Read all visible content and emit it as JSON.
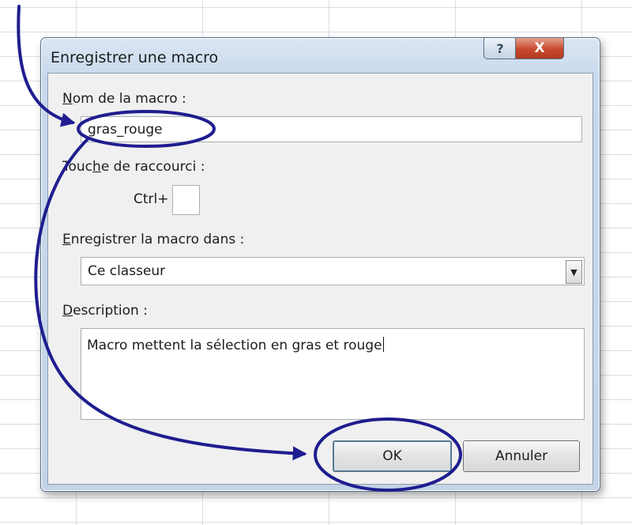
{
  "dialog": {
    "title": "Enregistrer une macro",
    "help_glyph": "?",
    "close_glyph": "X"
  },
  "macro_name": {
    "label_accel": "N",
    "label_rest": "om de la macro :",
    "value": "gras_rouge"
  },
  "shortcut": {
    "label_pre": "Touc",
    "label_accel": "h",
    "label_post": "e de raccourci :",
    "prefix": "Ctrl+",
    "value": ""
  },
  "store_in": {
    "label_accel": "E",
    "label_rest": "nregistrer la macro dans :",
    "selected": "Ce classeur"
  },
  "description": {
    "label_accel": "D",
    "label_rest": "escription :",
    "value": "Macro mettent la sélection en gras et rouge"
  },
  "buttons": {
    "ok": "OK",
    "cancel": "Annuler"
  },
  "annotation": {
    "color": "#1f1d8f"
  }
}
